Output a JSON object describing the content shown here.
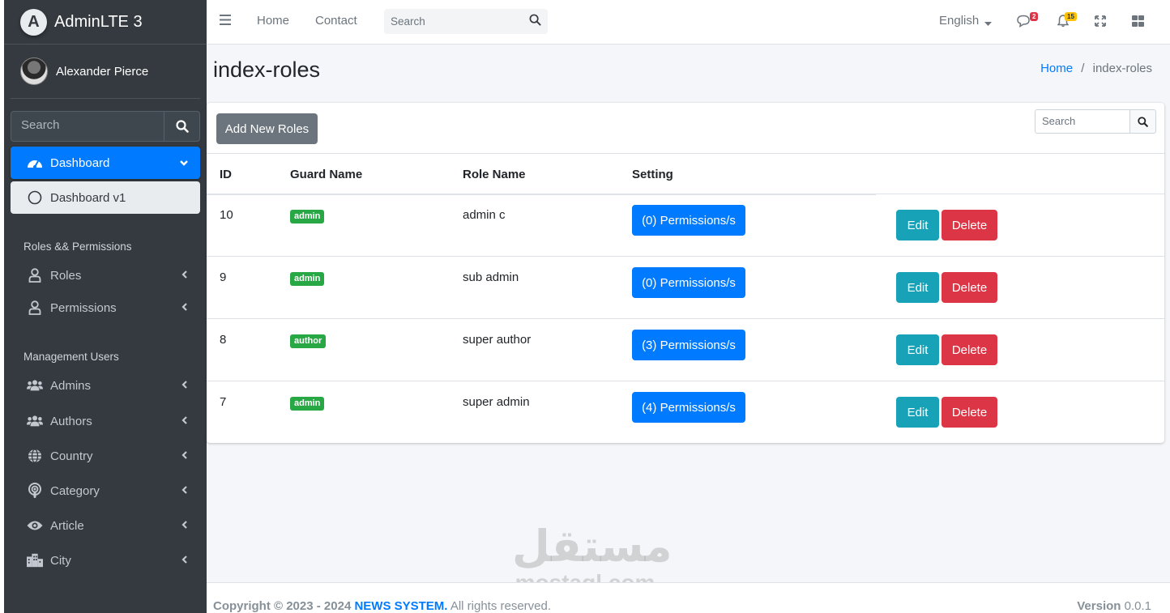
{
  "brand": {
    "letter": "A",
    "name": "AdminLTE 3"
  },
  "user": {
    "name": "Alexander Pierce"
  },
  "sidebar": {
    "search_placeholder": "Search",
    "dashboard": "Dashboard",
    "dashboard_v1": "Dashboard v1",
    "header_roles": "Roles && Permissions",
    "roles": "Roles",
    "permissions": "Permissions",
    "header_users": "Management Users",
    "admins": "Admins",
    "authors": "Authors",
    "country": "Country",
    "category": "Category",
    "article": "Article",
    "city": "City"
  },
  "topbar": {
    "home": "Home",
    "contact": "Contact",
    "search_placeholder": "Search",
    "language": "English",
    "messages_count": "2",
    "notifications_count": "15"
  },
  "page": {
    "title": "index-roles",
    "breadcrumb_home": "Home",
    "breadcrumb_sep": "/",
    "breadcrumb_current": "index-roles"
  },
  "card": {
    "add_button": "Add New Roles",
    "search_placeholder": "Search",
    "columns": [
      "ID",
      "Guard Name",
      "Role Name",
      "Setting"
    ],
    "rows": [
      {
        "id": "10",
        "guard": "admin",
        "role": "admin c",
        "permissions": "(0) Permissions/s",
        "edit": "Edit",
        "delete": "Delete"
      },
      {
        "id": "9",
        "guard": "admin",
        "role": "sub admin",
        "permissions": "(0) Permissions/s",
        "edit": "Edit",
        "delete": "Delete"
      },
      {
        "id": "8",
        "guard": "author",
        "role": "super author",
        "permissions": "(3) Permissions/s",
        "edit": "Edit",
        "delete": "Delete"
      },
      {
        "id": "7",
        "guard": "admin",
        "role": "super admin",
        "permissions": "(4) Permissions/s",
        "edit": "Edit",
        "delete": "Delete"
      }
    ]
  },
  "watermark": {
    "arabic": "مستقل",
    "latin": "mostaql.com"
  },
  "footer": {
    "copyright": "Copyright © 2023 - 2024",
    "site": "NEWS SYSTEM.",
    "rights": "All rights reserved.",
    "version_label": "Version",
    "version": "0.0.1"
  },
  "colors": {
    "primary": "#007bff",
    "sidebar": "#343a40",
    "success": "#28a745",
    "info": "#17a2b8",
    "danger": "#dc3545",
    "secondary": "#6c757d"
  }
}
